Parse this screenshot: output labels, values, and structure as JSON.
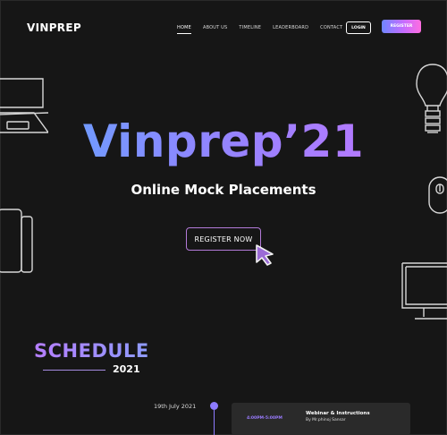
{
  "brand": {
    "name": "VINPREP"
  },
  "nav": {
    "items": [
      {
        "label": "HOME",
        "active": true
      },
      {
        "label": "ABOUT US",
        "active": false
      },
      {
        "label": "TIMELINE",
        "active": false
      },
      {
        "label": "LEADERBOARD",
        "active": false
      },
      {
        "label": "CONTACT",
        "active": false
      }
    ],
    "login_label": "LOGIN",
    "register_label": "REGISTER"
  },
  "hero": {
    "title": "Vinprep’21",
    "subtitle": "Online Mock Placements",
    "cta_label": "REGISTER NOW"
  },
  "schedule": {
    "title": "SCHEDULE",
    "year": "2021",
    "events": [
      {
        "date": "19th July 2021",
        "time": "4:00PM-5:00PM",
        "title": "Webinar & Instructions",
        "speaker": "By Mr.phinoj Sansar"
      }
    ]
  },
  "colors": {
    "background": "#161616",
    "accent_blue": "#5ea8ff",
    "accent_purple": "#c673ff",
    "accent_pink": "#ff6de0",
    "card": "#2a2a2a"
  },
  "icons": [
    "laptop-icon",
    "lightbulb-icon",
    "mouse-icon",
    "phone-icon",
    "monitor-icon",
    "cursor-icon"
  ]
}
